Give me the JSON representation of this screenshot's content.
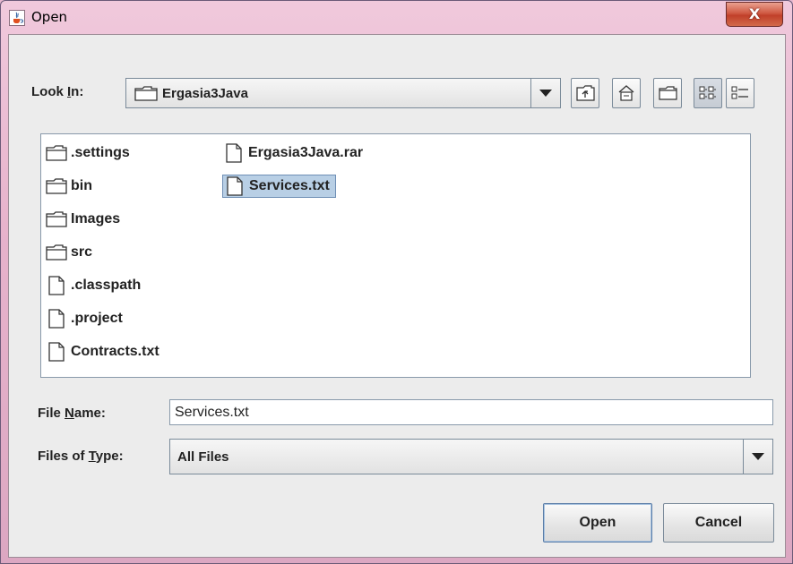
{
  "window": {
    "title": "Open",
    "close_label": "X"
  },
  "look_in": {
    "label_pre": "Look ",
    "label_mnemonic": "I",
    "label_post": "n:",
    "value": "Ergasia3Java"
  },
  "toolbar": {
    "buttons": [
      {
        "name": "up-one-level",
        "icon": "up-folder-icon"
      },
      {
        "name": "home",
        "icon": "home-icon"
      },
      {
        "name": "new-folder",
        "icon": "new-folder-icon"
      },
      {
        "name": "list-view",
        "icon": "list-view-icon",
        "pressed": true
      },
      {
        "name": "details-view",
        "icon": "details-view-icon"
      }
    ]
  },
  "files": {
    "column1": [
      {
        "name": ".settings",
        "type": "folder"
      },
      {
        "name": "bin",
        "type": "folder"
      },
      {
        "name": "Images",
        "type": "folder"
      },
      {
        "name": "src",
        "type": "folder"
      },
      {
        "name": ".classpath",
        "type": "file"
      },
      {
        "name": ".project",
        "type": "file"
      },
      {
        "name": "Contracts.txt",
        "type": "file"
      }
    ],
    "column2": [
      {
        "name": "Ergasia3Java.rar",
        "type": "file"
      },
      {
        "name": "Services.txt",
        "type": "file",
        "selected": true
      }
    ]
  },
  "file_name": {
    "label_pre": "File ",
    "label_mnemonic": "N",
    "label_post": "ame:",
    "value": "Services.txt"
  },
  "file_type": {
    "label_pre": "Files of ",
    "label_mnemonic": "T",
    "label_post": "ype:",
    "value": "All Files"
  },
  "buttons": {
    "open": "Open",
    "cancel": "Cancel"
  },
  "colors": {
    "selection": "#b8cfe5",
    "dialog_bg": "#ececec",
    "close_red": "#c0402a"
  }
}
